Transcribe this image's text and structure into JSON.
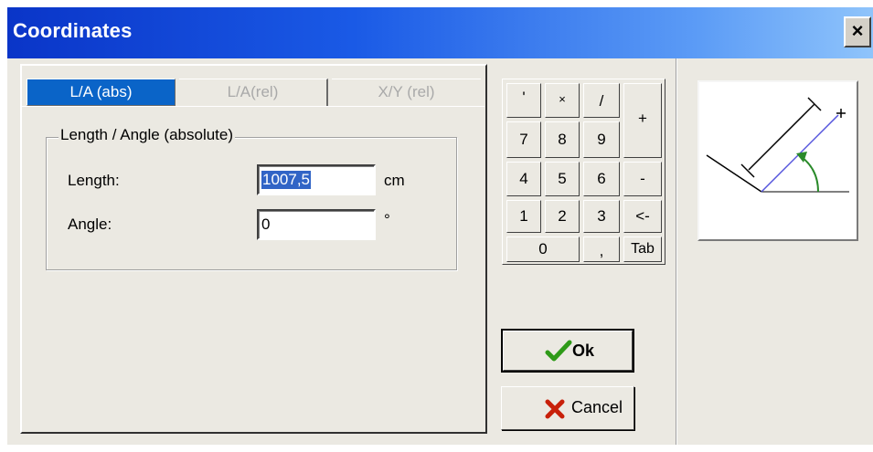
{
  "window": {
    "title": "Coordinates",
    "close_symbol": "×"
  },
  "tabs": [
    {
      "label": "L/A (abs)",
      "active": true
    },
    {
      "label": "L/A(rel)",
      "active": false
    },
    {
      "label": "X/Y (rel)",
      "active": false
    }
  ],
  "group": {
    "legend": "Length / Angle (absolute)",
    "length_label": "Length:",
    "length_value": "1007,5",
    "length_unit": "cm",
    "angle_label": "Angle:",
    "angle_value": "0",
    "angle_unit": "°"
  },
  "keypad": {
    "k_apos": "'",
    "k_times": "×",
    "k_div": "/",
    "k_plus": "+",
    "k7": "7",
    "k8": "8",
    "k9": "9",
    "k4": "4",
    "k5": "5",
    "k6": "6",
    "k_minus": "-",
    "k1": "1",
    "k2": "2",
    "k3": "3",
    "k_back": "<-",
    "k0": "0",
    "k_comma": ",",
    "k_tab": "Tab"
  },
  "buttons": {
    "ok_label": "Ok",
    "cancel_label": "Cancel"
  },
  "colors": {
    "title_start": "#0a35c8",
    "title_end": "#8fc4fb",
    "active_tab": "#0a64c8",
    "ok_check": "#2e9a18",
    "cancel_x": "#c8200a",
    "preview_line": "#5555dd",
    "preview_arrow": "#2a8a2a"
  },
  "icons": {
    "ok": "check-icon",
    "cancel": "x-icon",
    "preview": "length-angle-diagram-icon"
  }
}
